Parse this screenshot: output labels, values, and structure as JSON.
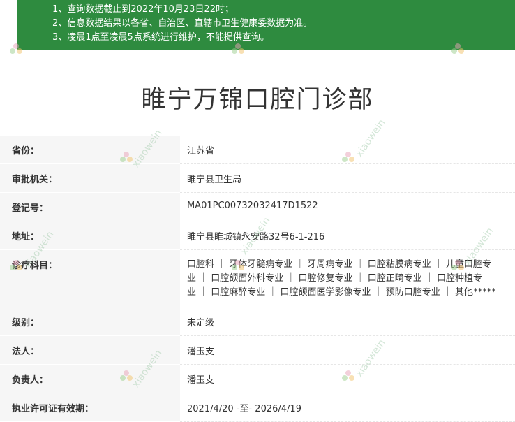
{
  "notice": {
    "lines": [
      "1、查询数据截止到2022年10月23日22时；",
      "2、信息数据结果以各省、自治区、直辖市卫生健康委数据为准。",
      "3、凌晨1点至凌晨5点系统进行维护，不能提供查询。"
    ]
  },
  "page": {
    "title": "睢宁万锦口腔门诊部"
  },
  "info": {
    "rows": [
      {
        "label": "省份：",
        "value": "江苏省"
      },
      {
        "label": "审批机关：",
        "value": "睢宁县卫生局"
      },
      {
        "label": "登记号：",
        "value": "MA01PC00732032417D1522"
      },
      {
        "label": "地址：",
        "value": "睢宁县睢城镇永安路32号6-1-216"
      },
      {
        "label": "诊疗科目：",
        "value_lines": [
          "口腔科 ｜ 牙体牙髓病专业 ｜ 牙周病专业 ｜ 口腔粘膜病专业 ｜ 儿童口腔专",
          "业 ｜ 口腔颌面外科专业 ｜ 口腔修复专业 ｜ 口腔正畸专业 ｜ 口腔种植专",
          "业 ｜ 口腔麻醉专业 ｜ 口腔颌面医学影像专业 ｜ 预防口腔专业 ｜ 其他*****"
        ]
      },
      {
        "label": "级别：",
        "value": "未定级"
      },
      {
        "label": "法人：",
        "value": "潘玉支"
      },
      {
        "label": "负责人：",
        "value": "潘玉支"
      },
      {
        "label": "执业许可证有效期：",
        "value": "2021/4/20 -至- 2026/4/19"
      }
    ]
  },
  "watermark": {
    "text": "xiaowein"
  },
  "colors": {
    "notice_bg": "#2e8b3f",
    "label_bg": "#f6f6f6",
    "text": "#333333"
  }
}
